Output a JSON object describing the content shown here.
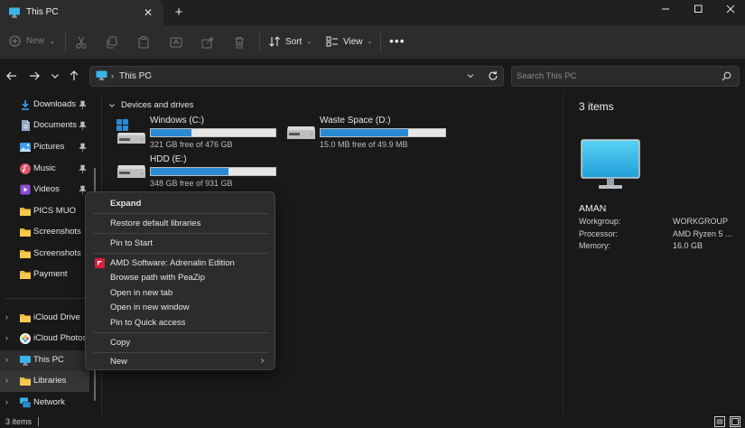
{
  "window": {
    "tab_title": "This PC",
    "tab_close": "✕",
    "new_tab": "+"
  },
  "toolbar": {
    "new_label": "New",
    "sort_label": "Sort",
    "view_label": "View",
    "more": "•••"
  },
  "address": {
    "location": "This PC",
    "search_placeholder": "Search This PC"
  },
  "sidebar": {
    "items": [
      {
        "label": "Downloads"
      },
      {
        "label": "Documents"
      },
      {
        "label": "Pictures"
      },
      {
        "label": "Music"
      },
      {
        "label": "Videos"
      },
      {
        "label": "PICS MUO"
      },
      {
        "label": "Screenshots"
      },
      {
        "label": "Screenshots"
      },
      {
        "label": "Payment"
      },
      {
        "label": "iCloud Drive"
      },
      {
        "label": "iCloud Photos"
      },
      {
        "label": "This PC"
      },
      {
        "label": "Libraries"
      },
      {
        "label": "Network"
      }
    ]
  },
  "main": {
    "section_label": "Devices and drives",
    "drives": [
      {
        "name": "Windows (C:)",
        "free_text": "321 GB free of 476 GB",
        "used_fraction": 0.326
      },
      {
        "name": "Waste Space (D:)",
        "free_text": "15.0 MB free of 49.9 MB",
        "used_fraction": 0.7
      },
      {
        "name": "HDD (E:)",
        "free_text": "348 GB free of 931 GB",
        "used_fraction": 0.626
      }
    ]
  },
  "context_menu": {
    "expand": "Expand",
    "restore": "Restore default libraries",
    "pin_start": "Pin to Start",
    "amd": "AMD Software: Adrenalin Edition",
    "peazip": "Browse path with PeaZip",
    "new_tab": "Open in new tab",
    "new_window": "Open in new window",
    "quick_access": "Pin to Quick access",
    "copy": "Copy",
    "new": "New"
  },
  "details": {
    "title": "3 items",
    "pc_name": "AMAN",
    "props": [
      {
        "label": "Workgroup:",
        "value": "WORKGROUP"
      },
      {
        "label": "Processor:",
        "value": "AMD Ryzen 5 ..."
      },
      {
        "label": "Memory:",
        "value": "16.0 GB"
      }
    ]
  },
  "status": {
    "count": "3 items"
  },
  "colors": {
    "accent": "#2a8ad4",
    "background": "#191919",
    "panel": "#2c2c2c",
    "folder": "#e8b540"
  }
}
